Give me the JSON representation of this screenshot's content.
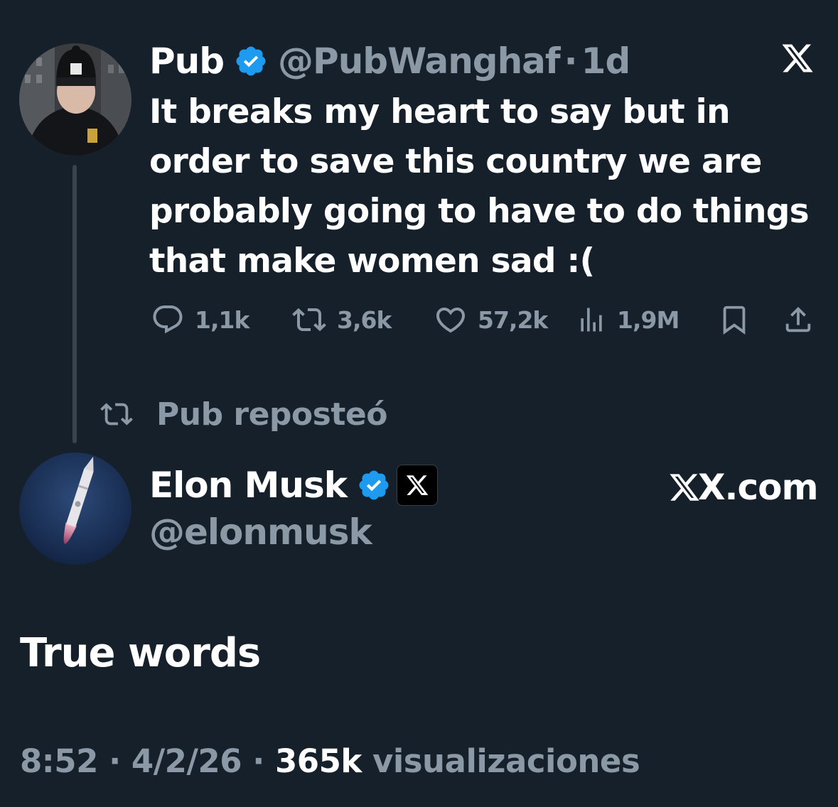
{
  "quoted_tweet": {
    "author_name": "Pub",
    "author_handle": "@PubWanghaf",
    "time_ago": "1d",
    "separator": "·",
    "text_lines": [
      "It breaks my heart to say but in",
      "order to save this country we are",
      "probably going to have to do things",
      "that make women sad :("
    ],
    "metrics": {
      "replies": "1,1k",
      "reposts": "3,6k",
      "likes": "57,2k",
      "views": "1,9M"
    }
  },
  "repost_banner": {
    "label": "Pub reposteó"
  },
  "main_tweet": {
    "author_name": "Elon Musk",
    "author_handle": "@elonmusk",
    "affiliate_link": "X.com",
    "text": "True words",
    "time": "8:52",
    "date": "4/2/26",
    "separator": "·",
    "views_count": "365k",
    "views_label": "visualizaciones"
  },
  "icons": {
    "verified": "verified-badge-icon",
    "x_logo": "x-logo-icon",
    "reply": "reply-icon",
    "repost": "repost-icon",
    "like": "heart-icon",
    "views": "views-icon",
    "bookmark": "bookmark-icon",
    "share": "share-icon"
  },
  "colors": {
    "background": "#15202b",
    "text_primary": "#ffffff",
    "text_secondary": "#8b98a5",
    "verified_blue": "#1d9bf0"
  }
}
